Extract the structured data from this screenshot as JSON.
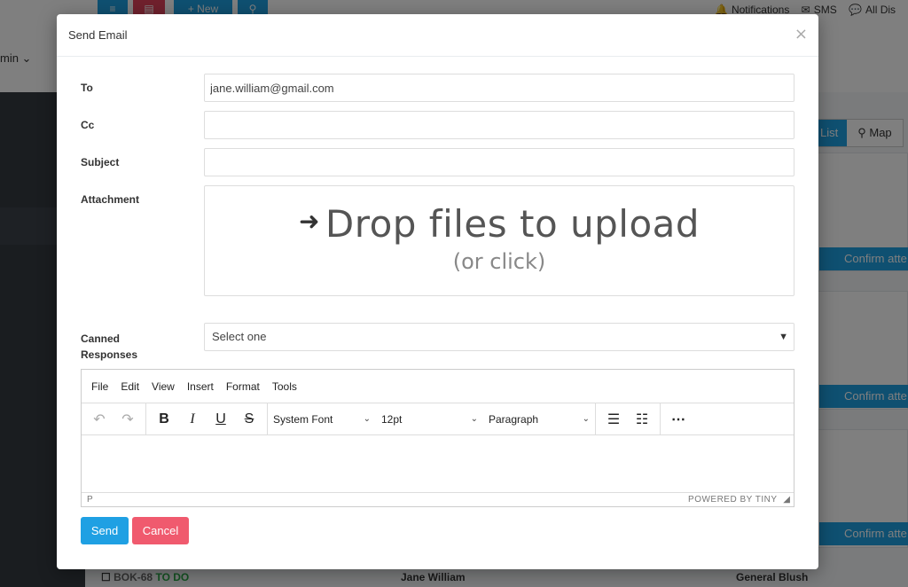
{
  "background": {
    "admin_label": "min ⌄",
    "new_button_label": "+ New",
    "menu": {
      "notifications": "Notifications",
      "sms": "SMS",
      "all": "All Dis"
    },
    "view_toggle": {
      "list_label": "List",
      "map_label": "Map"
    },
    "confirm_label": "Confirm atte",
    "bottom_row": {
      "booking_id": "BOK-68",
      "booking_status": "TO DO",
      "assignee": "Jane William",
      "assignee2": "General Blush"
    }
  },
  "modal": {
    "title": "Send Email",
    "close_symbol": "×",
    "fields": {
      "to_label": "To",
      "to_value": "jane.william@gmail.com",
      "cc_label": "Cc",
      "cc_value": "",
      "subject_label": "Subject",
      "subject_value": "",
      "attachment_label": "Attachment",
      "canned_label_line1": "Canned",
      "canned_label_line2": "Responses",
      "canned_selected": "Select one"
    },
    "dropzone": {
      "main_text": "Drop files to upload",
      "sub_text": "(or click)"
    },
    "editor": {
      "menu": [
        "File",
        "Edit",
        "View",
        "Insert",
        "Format",
        "Tools"
      ],
      "font_family": "System Font",
      "font_size": "12pt",
      "block_format": "Paragraph",
      "status_path": "P",
      "powered_by": "POWERED BY TINY"
    },
    "buttons": {
      "send": "Send",
      "cancel": "Cancel"
    }
  }
}
